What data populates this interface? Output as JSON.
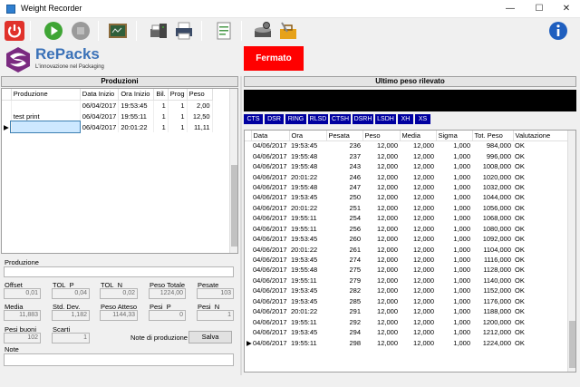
{
  "window": {
    "title": "Weight Recorder",
    "minimize": "—",
    "maximize": "☐",
    "close": "✕"
  },
  "toolbar": {
    "colors": {
      "power": "#e0322b",
      "play": "#3fa535",
      "stop": "#9a9a9a",
      "info": "#1f5fbf"
    }
  },
  "brand": {
    "name": "RePacks",
    "tagline": "L'innovazione nel Packaging"
  },
  "status": {
    "label": "Fermato",
    "color": "#ff0000"
  },
  "produzioni": {
    "header": "Produzioni",
    "columns": [
      "Produzione",
      "Data Inizio",
      "Ora Inizio",
      "Bil.",
      "Prog",
      "Peso"
    ],
    "rows": [
      [
        "",
        "06/04/2017",
        "19:53:45",
        "1",
        "1",
        "2,00"
      ],
      [
        "test print",
        "06/04/2017",
        "19:55:11",
        "1",
        "1",
        "12,50"
      ],
      [
        "",
        "06/04/2017",
        "20:01:22",
        "1",
        "1",
        "11,11"
      ]
    ]
  },
  "form": {
    "produzione_label": "Produzione",
    "produzione_value": "",
    "offset_label": "Offset",
    "offset_value": "0,01",
    "tolp_label": "TOL_P",
    "tolp_value": "0,04",
    "toln_label": "TOL_N",
    "toln_value": "0,02",
    "pesototale_label": "Peso Totale",
    "pesototale_value": "1224,00",
    "pesate_label": "Pesate",
    "pesate_value": "103",
    "media_label": "Media",
    "media_value": "11,883",
    "stddev_label": "Std. Dev.",
    "stddev_value": "1,182",
    "pesoatteso_label": "Peso Atteso",
    "pesoatteso_value": "1144,33",
    "pesip_label": "Pesi_P",
    "pesip_value": "0",
    "pesin_label": "Pesi_N",
    "pesin_value": "1",
    "pesibuoni_label": "Pesi buoni",
    "pesibuoni_value": "102",
    "scarti_label": "Scarti",
    "scarti_value": "1",
    "noteprod_label": "Note di produzione",
    "salva_label": "Salva",
    "note_label": "Note",
    "note_value": ""
  },
  "ultimo": {
    "header": "Ultimo peso rilevato",
    "signals": [
      "CTS",
      "DSR",
      "RING",
      "RLSD",
      "CTSH",
      "DSRH",
      "LSDH",
      "XH",
      "XS"
    ],
    "columns": [
      "Data",
      "Ora",
      "Pesata",
      "Peso",
      "Media",
      "Sigma",
      "Tot. Peso",
      "Valutazione"
    ],
    "rows": [
      [
        "04/06/2017",
        "19:53:45",
        "236",
        "12,000",
        "12,000",
        "1,000",
        "984,000",
        "OK"
      ],
      [
        "04/06/2017",
        "19:55:48",
        "237",
        "12,000",
        "12,000",
        "1,000",
        "996,000",
        "OK"
      ],
      [
        "04/06/2017",
        "19:55:48",
        "243",
        "12,000",
        "12,000",
        "1,000",
        "1008,000",
        "OK"
      ],
      [
        "04/06/2017",
        "20:01:22",
        "246",
        "12,000",
        "12,000",
        "1,000",
        "1020,000",
        "OK"
      ],
      [
        "04/06/2017",
        "19:55:48",
        "247",
        "12,000",
        "12,000",
        "1,000",
        "1032,000",
        "OK"
      ],
      [
        "04/06/2017",
        "19:53:45",
        "250",
        "12,000",
        "12,000",
        "1,000",
        "1044,000",
        "OK"
      ],
      [
        "04/06/2017",
        "20:01:22",
        "251",
        "12,000",
        "12,000",
        "1,000",
        "1056,000",
        "OK"
      ],
      [
        "04/06/2017",
        "19:55:11",
        "254",
        "12,000",
        "12,000",
        "1,000",
        "1068,000",
        "OK"
      ],
      [
        "04/06/2017",
        "19:55:11",
        "256",
        "12,000",
        "12,000",
        "1,000",
        "1080,000",
        "OK"
      ],
      [
        "04/06/2017",
        "19:53:45",
        "260",
        "12,000",
        "12,000",
        "1,000",
        "1092,000",
        "OK"
      ],
      [
        "04/06/2017",
        "20:01:22",
        "261",
        "12,000",
        "12,000",
        "1,000",
        "1104,000",
        "OK"
      ],
      [
        "04/06/2017",
        "19:53:45",
        "274",
        "12,000",
        "12,000",
        "1,000",
        "1116,000",
        "OK"
      ],
      [
        "04/06/2017",
        "19:55:48",
        "275",
        "12,000",
        "12,000",
        "1,000",
        "1128,000",
        "OK"
      ],
      [
        "04/06/2017",
        "19:55:11",
        "279",
        "12,000",
        "12,000",
        "1,000",
        "1140,000",
        "OK"
      ],
      [
        "04/06/2017",
        "19:53:45",
        "282",
        "12,000",
        "12,000",
        "1,000",
        "1152,000",
        "OK"
      ],
      [
        "04/06/2017",
        "19:53:45",
        "285",
        "12,000",
        "12,000",
        "1,000",
        "1176,000",
        "OK"
      ],
      [
        "04/06/2017",
        "20:01:22",
        "291",
        "12,000",
        "12,000",
        "1,000",
        "1188,000",
        "OK"
      ],
      [
        "04/06/2017",
        "19:55:11",
        "292",
        "12,000",
        "12,000",
        "1,000",
        "1200,000",
        "OK"
      ],
      [
        "04/06/2017",
        "19:53:45",
        "294",
        "12,000",
        "12,000",
        "1,000",
        "1212,000",
        "OK"
      ],
      [
        "04/06/2017",
        "19:55:11",
        "298",
        "12,000",
        "12,000",
        "1,000",
        "1224,000",
        "OK"
      ]
    ]
  }
}
